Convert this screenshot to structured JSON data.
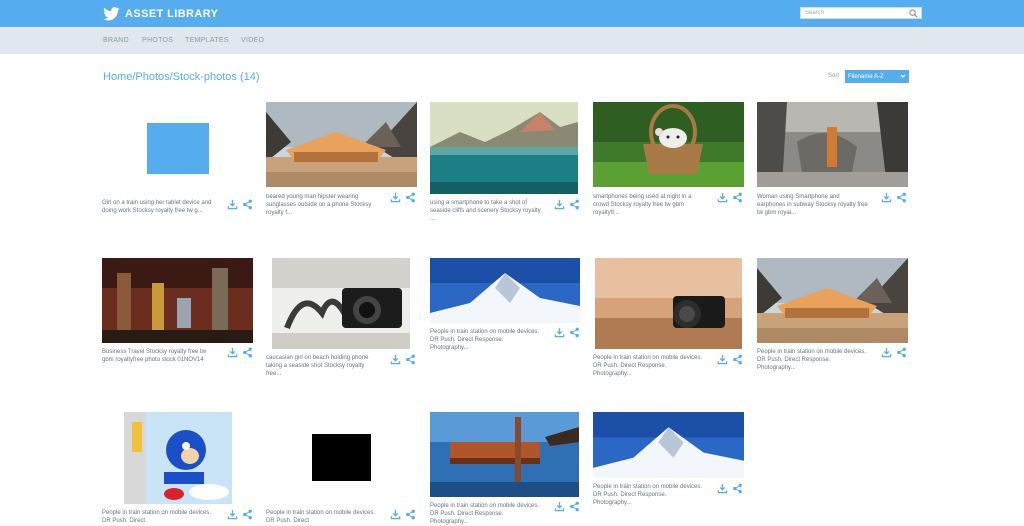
{
  "header": {
    "title": "ASSET LIBRARY",
    "search_placeholder": "Search"
  },
  "nav": [
    "BRAND",
    "PHOTOS",
    "TEMPLATES",
    "VIDEO"
  ],
  "breadcrumb": "Home/Photos/Stock-photos (14)",
  "sort": {
    "label": "Sort",
    "value": "Filename A-Z"
  },
  "colors": {
    "accent": "#55acee",
    "nav_bg": "#e1e8ed",
    "caption": "#66757f"
  },
  "cards": [
    {
      "caption": "Girl on a train using her tablet device and doing work Stocksy royalty free tw g...",
      "thumb": "blue-square-icon"
    },
    {
      "caption": "beared young man hipster wearing sunglasses outside on a phone Stocksy royalty f...",
      "thumb": "desert-tent-image"
    },
    {
      "caption": "using a smartphone to take a shot of seaside cliffs and scenery Stocksy royalty ...",
      "thumb": "lake-mountains-image"
    },
    {
      "caption": "smartphones being used at night in a crowd Stocksy royalty free tw gbm royaltyfr...",
      "thumb": "puppy-basket-image"
    },
    {
      "caption": "Woman using Smartphone and earphones in subway Stocksy royalty free tw gbm royal...",
      "thumb": "scifi-robot-image"
    },
    {
      "caption": "Business Travel Stocksy royalty free tw gbm royaltyfree photo stock 01NOV14",
      "thumb": "robots-scene-image"
    },
    {
      "caption": "caucasian girl on beach holding phone taking a seaside shot Stocksy royalty free...",
      "thumb": "camera-film-image"
    },
    {
      "caption": "People in train station on mobile devices. DR Push. Direct Response. Photography...",
      "thumb": "snow-mountain-image"
    },
    {
      "caption": "People in train station on mobile devices. DR Push. Direct Response. Photography...",
      "thumb": "camera-sand-image"
    },
    {
      "caption": "People in train station on mobile devices. DR Push. Direct Response. Photography...",
      "thumb": "desert-tent-image"
    },
    {
      "caption": "People in train station on mobile devices. DR Push. Direct",
      "thumb": "sonic-image"
    },
    {
      "caption": "People in train station on mobile devices. DR Push. Direct",
      "thumb": "black-square-icon"
    },
    {
      "caption": "People in train station on mobile devices. DR Push. Direct Response. Photography...",
      "thumb": "space-station-image"
    },
    {
      "caption": "People in train station on mobile devices. DR Push. Direct Response. Photography...",
      "thumb": "snow-mountain-image"
    }
  ]
}
